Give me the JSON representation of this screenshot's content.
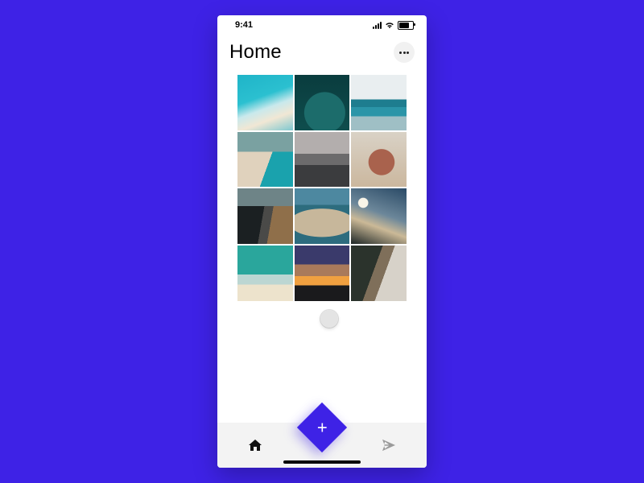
{
  "status": {
    "time": "9:41"
  },
  "header": {
    "title": "Home"
  },
  "grid": {
    "tiles": [
      {
        "name": "photo-tile-1"
      },
      {
        "name": "photo-tile-2"
      },
      {
        "name": "photo-tile-3"
      },
      {
        "name": "photo-tile-4"
      },
      {
        "name": "photo-tile-5"
      },
      {
        "name": "photo-tile-6"
      },
      {
        "name": "photo-tile-7"
      },
      {
        "name": "photo-tile-8"
      },
      {
        "name": "photo-tile-9"
      },
      {
        "name": "photo-tile-10"
      },
      {
        "name": "photo-tile-11"
      },
      {
        "name": "photo-tile-12"
      }
    ]
  },
  "nav": {
    "add_label": "+"
  },
  "colors": {
    "accent": "#3e22e6"
  }
}
